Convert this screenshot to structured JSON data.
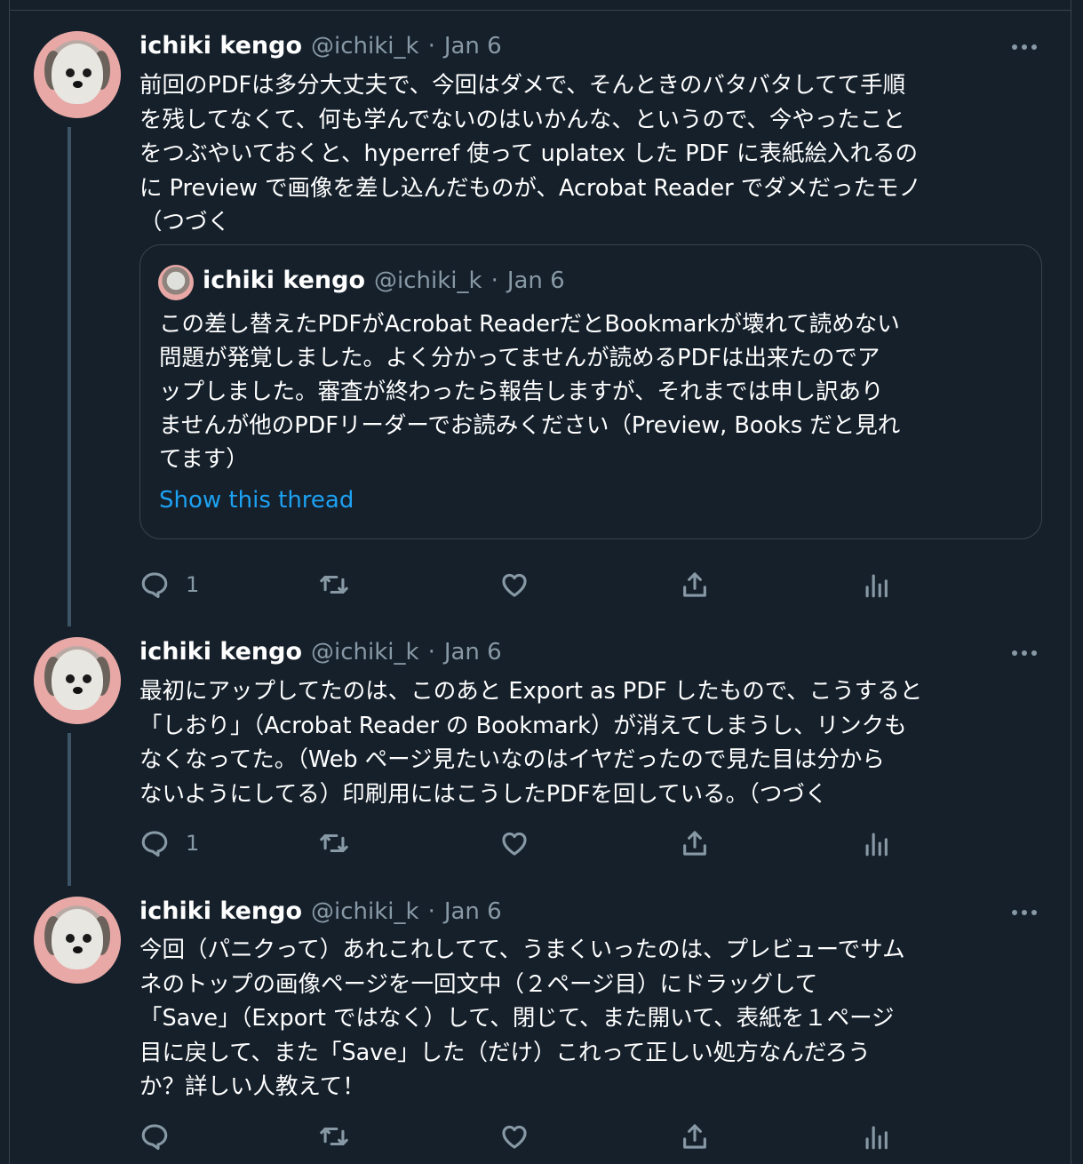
{
  "tweets": [
    {
      "name": "ichiki kengo",
      "handle": "@ichiki_k",
      "dot": "·",
      "date": "Jan 6",
      "text": "前回のPDFは多分大丈夫で、今回はダメで、そんときのバタバタしてて手順\nを残してなくて、何も学んでないのはいかんな、というので、今やったこと\nをつぶやいておくと、hyperref 使って uplatex した PDF に表紙絵入れるの\nに Preview で画像を差し込んだものが、Acrobat Reader でダメだったモノ\n（つづく",
      "quote": {
        "name": "ichiki kengo",
        "handle": "@ichiki_k",
        "dot": "·",
        "date": "Jan 6",
        "text": "この差し替えたPDFがAcrobat ReaderだとBookmarkが壊れて読めない\n問題が発覚しました。よく分かってませんが読めるPDFは出来たのでア\nップしました。審査が終わったら報告しますが、それまでは申し訳あり\nませんが他のPDFリーダーでお読みください（Preview, Books だと見れ\nてます）",
        "show_thread": "Show this thread"
      },
      "reply_count": "1"
    },
    {
      "name": "ichiki kengo",
      "handle": "@ichiki_k",
      "dot": "·",
      "date": "Jan 6",
      "text": "最初にアップしてたのは、このあと Export as PDF したもので、こうすると\n「しおり」（Acrobat Reader の Bookmark）が消えてしまうし、リンクも\nなくなってた。（Web ページ見たいなのはイヤだったので見た目は分から\nないようにしてる）印刷用にはこうしたPDFを回している。（つづく",
      "reply_count": "1"
    },
    {
      "name": "ichiki kengo",
      "handle": "@ichiki_k",
      "dot": "·",
      "date": "Jan 6",
      "text": "今回（パニクって）あれこれしてて、うまくいったのは、プレビューでサム\nネのトップの画像ページを一回文中（２ページ目）にドラッグして\n「Save」（Export ではなく）して、閉じて、また開いて、表紙を１ページ\n目に戻して、また「Save」した（だけ）これって正しい処方なんだろう\nか？詳しい人教えて！",
      "reply_count": ""
    }
  ],
  "icons": [
    "reply-icon",
    "retweet-icon",
    "like-icon",
    "share-icon",
    "analytics-icon",
    "more-icon"
  ],
  "colors": {
    "background": "#15202b",
    "secondary_text": "#8899a6",
    "link": "#1da1f2",
    "border": "#38444d",
    "thread_line": "#3d5466"
  }
}
